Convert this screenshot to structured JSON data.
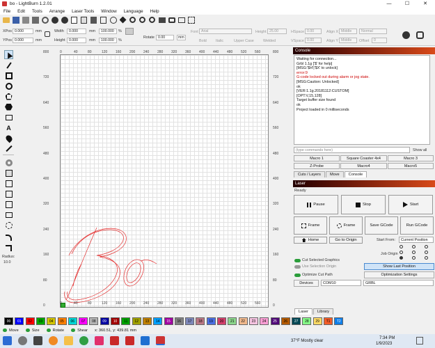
{
  "window": {
    "title": "bo - LightBurn 1.2.01",
    "min": "—",
    "max": "☐",
    "close": "✕"
  },
  "menu": [
    "File",
    "Edit",
    "Tools",
    "Arrange",
    "Laser Tools",
    "Window",
    "Language",
    "Help"
  ],
  "toolbar2": {
    "xpos_label": "XPos",
    "xpos": "0.000",
    "ypos_label": "YPos",
    "ypos": "0.000",
    "mm": "mm",
    "width_label": "Width",
    "width": "0.000",
    "height_label": "Height",
    "height": "0.000",
    "wpct": "100.000",
    "hpct": "100.000",
    "pct": "%",
    "rotate_label": "Rotate",
    "rotate": "0.00",
    "mm2": "mm",
    "font_label": "Font",
    "font": "Arial",
    "fheight_label": "Height",
    "fheight": "25.00",
    "hspace_label": "HSpace",
    "hspace": "0.00",
    "vspace_label": "VSpace",
    "vspace": "0.00",
    "alignx_label": "Align X",
    "alignx": "Middle",
    "aligny_label": "Align Y",
    "aligny": "Middle",
    "normal": "Normal",
    "offset_label": "Offset",
    "offset": "0",
    "bold": "Bold",
    "italic": "Italic",
    "upper": "Upper Case",
    "welded": "Welded"
  },
  "ruler": {
    "top": [
      "0",
      "40",
      "80",
      "120",
      "160",
      "200",
      "240",
      "280",
      "320",
      "360",
      "400",
      "440",
      "480",
      "520",
      "560"
    ],
    "left": [
      "800",
      "720",
      "640",
      "560",
      "480",
      "400",
      "320",
      "240",
      "160",
      "80",
      "0"
    ],
    "right": [
      "800",
      "720",
      "640",
      "560",
      "480",
      "400",
      "320",
      "240",
      "160",
      "80",
      "0"
    ],
    "bottom": [
      "0",
      "40",
      "80",
      "120",
      "160",
      "200",
      "240",
      "280",
      "320",
      "360",
      "400",
      "440",
      "480",
      "520",
      "560"
    ]
  },
  "leftpanel": {
    "radius_label": "Radius:",
    "radius": "10.0"
  },
  "console": {
    "title": "Console",
    "lines": [
      {
        "t": "Waiting for connection...",
        "c": ""
      },
      {
        "t": "Grbl 1.1g ['$' for help]",
        "c": ""
      },
      {
        "t": "[MSG:'$H'|'$X' to unlock]",
        "c": ""
      },
      {
        "t": "error:9",
        "c": "red"
      },
      {
        "t": "G-code locked out during alarm or jog state.",
        "c": "red"
      },
      {
        "t": "[MSG:Caution: Unlocked]",
        "c": ""
      },
      {
        "t": "ok",
        "c": ""
      },
      {
        "t": "[VER:1.1g.20181112:CUSTOM]",
        "c": ""
      },
      {
        "t": "[OPT:V,15,128]",
        "c": ""
      },
      {
        "t": "Target buffer size found",
        "c": ""
      },
      {
        "t": "ok",
        "c": ""
      },
      {
        "t": "Project loaded in 0 milliseconds",
        "c": ""
      }
    ],
    "cmd_placeholder": "(type commands here)",
    "showall": "Show all",
    "macros": [
      "Macro 1",
      "Square Coaster 4x4",
      "Macro 3",
      "Z-Probe",
      "Macro4",
      "Macro5"
    ],
    "tabs": [
      "Cuts / Layers",
      "Move",
      "Console"
    ]
  },
  "laser": {
    "title": "Laser",
    "status": "Ready",
    "pause": "Pause",
    "stop": "Stop",
    "start": "Start",
    "frame1": "Frame",
    "frame2": "Frame",
    "save": "Save GCode",
    "run": "Run GCode",
    "home": "Home",
    "origin": "Go to Origin",
    "startfrom_label": "Start From:",
    "startfrom": "Current Position",
    "joborigin": "Job Origin",
    "cutsel": "Cut Selected Graphics",
    "usesel": "Use Selection Origin",
    "optimize": "Optimize Cut Path",
    "showlast": "Show Last Position",
    "optset": "Optimization Settings",
    "devices": "Devices",
    "port": "COM10",
    "firmware": "GRBL",
    "tabs": [
      "Laser",
      "Library"
    ]
  },
  "palette": [
    {
      "n": "00",
      "c": "#000000",
      "f": "#ffffff"
    },
    {
      "n": "01",
      "c": "#0000ff",
      "f": "#ffffff"
    },
    {
      "n": "02",
      "c": "#ff0000",
      "f": "#000"
    },
    {
      "n": "03",
      "c": "#00aa00",
      "f": "#000"
    },
    {
      "n": "04",
      "c": "#d2c400",
      "f": "#000"
    },
    {
      "n": "05",
      "c": "#ff7f00",
      "f": "#000"
    },
    {
      "n": "06",
      "c": "#00d6d6",
      "f": "#000"
    },
    {
      "n": "07",
      "c": "#ff00ff",
      "f": "#000"
    },
    {
      "n": "08",
      "c": "#b4b4b4",
      "f": "#000"
    },
    {
      "n": "09",
      "c": "#0000a0",
      "f": "#fff"
    },
    {
      "n": "10",
      "c": "#a00000",
      "f": "#fff"
    },
    {
      "n": "11",
      "c": "#00a000",
      "f": "#000"
    },
    {
      "n": "12",
      "c": "#a0a000",
      "f": "#000"
    },
    {
      "n": "13",
      "c": "#c08000",
      "f": "#000"
    },
    {
      "n": "14",
      "c": "#00a0ff",
      "f": "#000"
    },
    {
      "n": "15",
      "c": "#a000a0",
      "f": "#fff"
    },
    {
      "n": "16",
      "c": "#808080",
      "f": "#000"
    },
    {
      "n": "17",
      "c": "#7d87b9",
      "f": "#000"
    },
    {
      "n": "18",
      "c": "#bb7784",
      "f": "#000"
    },
    {
      "n": "19",
      "c": "#4a6fe3",
      "f": "#000"
    },
    {
      "n": "20",
      "c": "#d33f6a",
      "f": "#000"
    },
    {
      "n": "21",
      "c": "#8cd78c",
      "f": "#000"
    },
    {
      "n": "22",
      "c": "#f0b98d",
      "f": "#000"
    },
    {
      "n": "23",
      "c": "#f6c4e1",
      "f": "#000"
    },
    {
      "n": "24",
      "c": "#fa9ed4",
      "f": "#000"
    },
    {
      "n": "25",
      "c": "#500a78",
      "f": "#fff"
    },
    {
      "n": "26",
      "c": "#b45a00",
      "f": "#000"
    },
    {
      "n": "27",
      "c": "#004754",
      "f": "#fff"
    },
    {
      "n": "28",
      "c": "#86fa88",
      "f": "#000"
    },
    {
      "n": "29",
      "c": "#ffdb66",
      "f": "#000"
    },
    {
      "n": "T1",
      "c": "#f35c28",
      "f": "#000"
    },
    {
      "n": "T2",
      "c": "#0f7ee8",
      "f": "#fff"
    }
  ],
  "status": {
    "move": "Move",
    "size": "Size",
    "rotate": "Rotate",
    "shear": "Shear",
    "coords": "x: 360.51, y: 439.81 mm"
  },
  "taskbar": {
    "weather": "37°F  Mostly clear",
    "time": "7:34 PM",
    "date": "1/9/2023"
  }
}
